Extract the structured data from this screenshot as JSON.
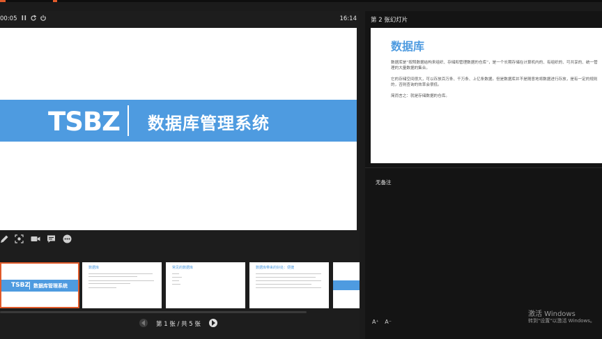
{
  "presenter": {
    "timer": "00:05",
    "clock": "16:14",
    "pause_icon": "pause-icon",
    "restart_icon": "restart-icon",
    "power_icon": "power-icon"
  },
  "current_slide": {
    "brand": "TSBZ",
    "system_name": "数据库管理系统",
    "banner_color": "#4e9be0"
  },
  "tools": [
    "pen-icon",
    "zoom-icon",
    "camera-icon",
    "subtitle-icon",
    "more-icon"
  ],
  "thumbnails": [
    {
      "brand": "TSBZ",
      "system_name": "数据库管理系统"
    },
    {
      "title": "数据库"
    },
    {
      "title": "常见的数据库"
    },
    {
      "title": "数据库带来的好处：便捷"
    },
    {
      "title": ""
    }
  ],
  "pager": {
    "text": "第 1 张 / 共 5 张"
  },
  "next_panel": {
    "title": "第 2 张幻灯片",
    "slide_title": "数据库",
    "para1": "数据库是“按照数据结构来组织、存储和管理数据的仓库”，是一个长期存储在计算机内的、有组织的、可共享的、统一管理的大量数据的集合。",
    "para2": "它的存储空间很大，可以存放百万条、千万条、上亿条数据。但是数据库并不是随意地将数据进行存放，是有一定的规则的，否则查询的效率会很低。",
    "para3": "简而言之：就是存储数据的仓库。"
  },
  "notes": {
    "text": "无备注"
  },
  "font_controls": {
    "increase": "A⁺",
    "decrease": "A⁻"
  },
  "watermark": {
    "line1": "激活 Windows",
    "line2": "转到\"设置\"以激活 Windows。"
  }
}
